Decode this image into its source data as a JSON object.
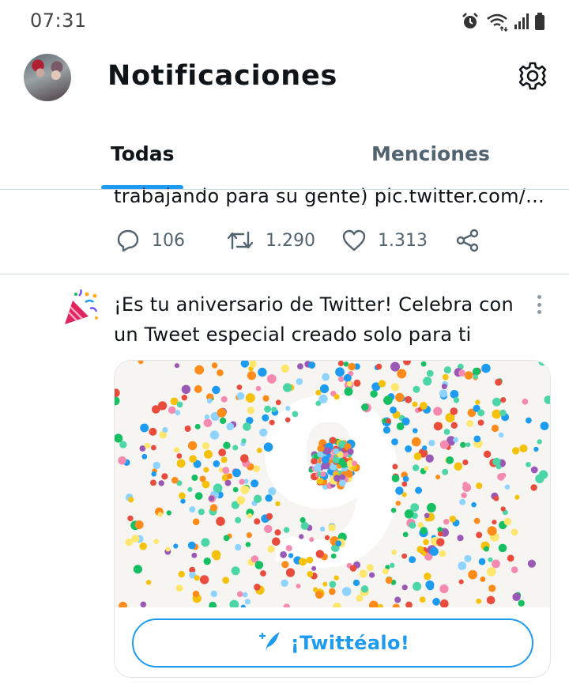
{
  "status_bar": {
    "time": "07:31",
    "icons": [
      "alarm-icon",
      "wifi-icon",
      "signal-icon",
      "battery-icon"
    ]
  },
  "header": {
    "title": "Notificaciones",
    "avatar": "profile-avatar",
    "settings_icon": "gear-icon"
  },
  "tabs": [
    {
      "label": "Todas",
      "active": true
    },
    {
      "label": "Menciones",
      "active": false
    }
  ],
  "previous_tweet": {
    "text": "trabajando para su gente) pic.twitter.com/...",
    "replies": "106",
    "retweets": "1.290",
    "likes": "1.313"
  },
  "anniversary": {
    "icon": "party-popper-icon",
    "line1": "¡Es tu aniversario de Twitter! Celebra con",
    "line2": "un Tweet especial creado solo para ti",
    "image_number": "9",
    "button_label": "¡Twittéalo!"
  },
  "colors": {
    "accent": "#1d9bf0",
    "text": "#0f1419",
    "secondary": "#536471",
    "divider": "#cfd9de"
  }
}
